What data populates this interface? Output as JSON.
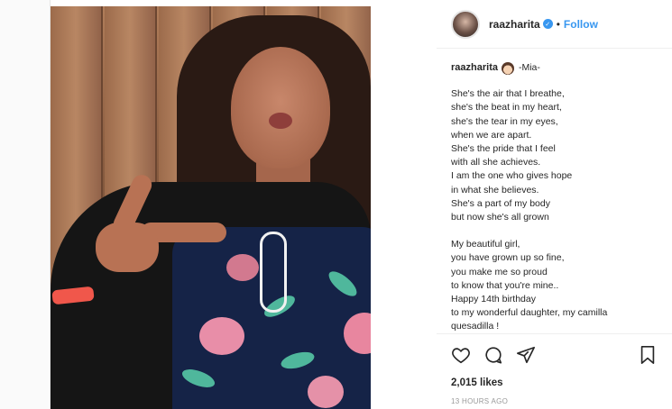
{
  "post": {
    "username": "raazharita",
    "follow_label": "Follow",
    "separator": "•",
    "caption_title": "-Mia-",
    "verses": [
      [
        "She's the air that I breathe,",
        "she's the beat in my heart,",
        "she's the tear in my eyes,",
        "when we are apart.",
        "She's the pride that I feel",
        "with all she achieves.",
        "I am the one who gives hope",
        "in what she believes.",
        "She's a part of my body",
        "but now she's all grown"
      ],
      [
        "My beautiful girl,",
        "you have grown up so fine,",
        "you make me so proud",
        "to know that you're mine..",
        "Happy 14th birthday",
        "to my wonderful daughter, my camilla",
        "quesadilla !"
      ]
    ],
    "likes": "2,015 likes",
    "timestamp": "13 HOURS AGO",
    "next_glyph": "›"
  },
  "icons": [
    "heart-icon",
    "comment-icon",
    "share-icon",
    "bookmark-icon",
    "verified-icon",
    "chevron-right-icon"
  ],
  "colors": {
    "accent": "#3897f0",
    "text": "#262626",
    "muted": "#999999",
    "border": "#efefef"
  }
}
